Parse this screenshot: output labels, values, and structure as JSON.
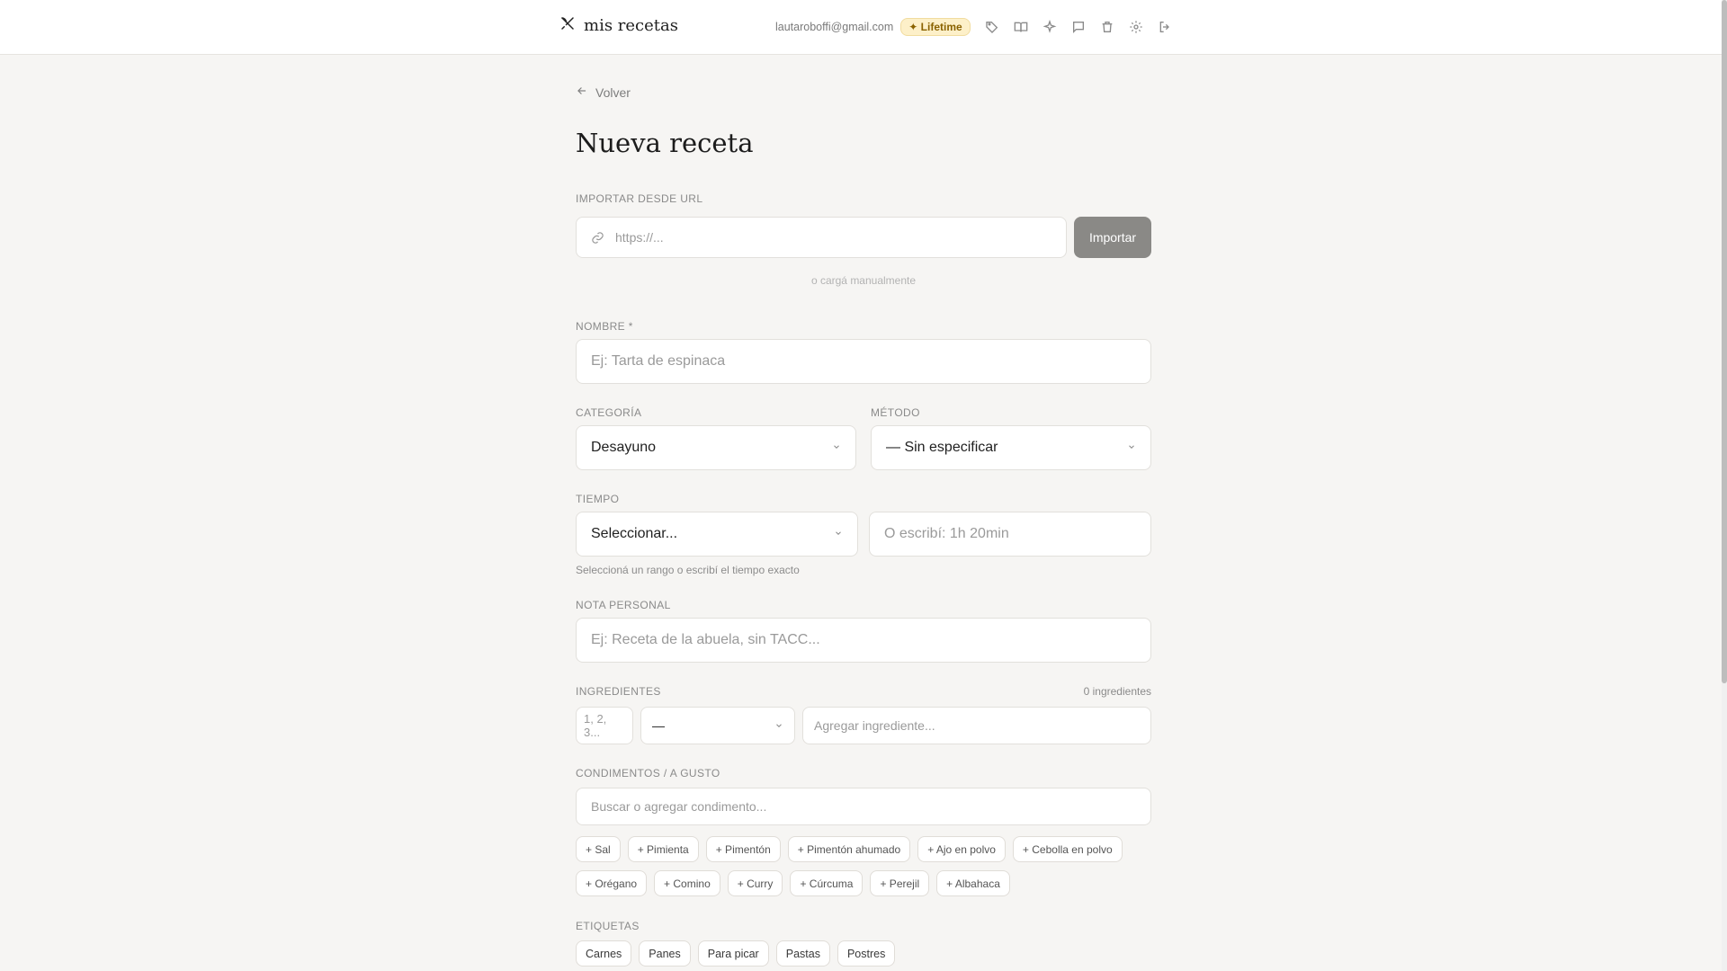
{
  "header": {
    "brand": "mis recetas",
    "email": "lautaroboffi@gmail.com",
    "badge": "✦ Lifetime",
    "icons": [
      "tag-icon",
      "book-icon",
      "sparkles-icon",
      "message-icon",
      "trash-icon",
      "gear-icon",
      "logout-icon"
    ]
  },
  "back_label": "Volver",
  "title": "Nueva receta",
  "import": {
    "label": "IMPORTAR DESDE URL",
    "placeholder": "https://...",
    "button": "Importar",
    "manual_hint": "o cargá manualmente"
  },
  "nombre": {
    "label": "NOMBRE *",
    "placeholder": "Ej: Tarta de espinaca"
  },
  "categoria": {
    "label": "CATEGORÍA",
    "value": "Desayuno"
  },
  "metodo": {
    "label": "MÉTODO",
    "value": "— Sin especificar"
  },
  "tiempo": {
    "label": "TIEMPO",
    "select_value": "Seleccionar...",
    "placeholder": "O escribí: 1h 20min",
    "hint": "Seleccioná un rango o escribí el tiempo exacto"
  },
  "nota": {
    "label": "NOTA PERSONAL",
    "placeholder": "Ej: Receta de la abuela, sin TACC..."
  },
  "ingredientes": {
    "label": "INGREDIENTES",
    "count": "0 ingredientes",
    "qty_placeholder": "1, 2, 3...",
    "unit_value": "—",
    "input_placeholder": "Agregar ingrediente..."
  },
  "condimentos": {
    "label": "CONDIMENTOS / A GUSTO",
    "placeholder": "Buscar o agregar condimento...",
    "row1": [
      "+ Sal",
      "+ Pimienta",
      "+ Pimentón",
      "+ Pimentón ahumado",
      "+ Ajo en polvo",
      "+ Cebolla en polvo"
    ],
    "row2": [
      "+ Orégano",
      "+ Comino",
      "+ Curry",
      "+ Cúrcuma",
      "+ Perejil",
      "+ Albahaca"
    ]
  },
  "etiquetas": {
    "label": "ETIQUETAS",
    "items": [
      "Carnes",
      "Panes",
      "Para picar",
      "Pastas",
      "Postres"
    ]
  }
}
